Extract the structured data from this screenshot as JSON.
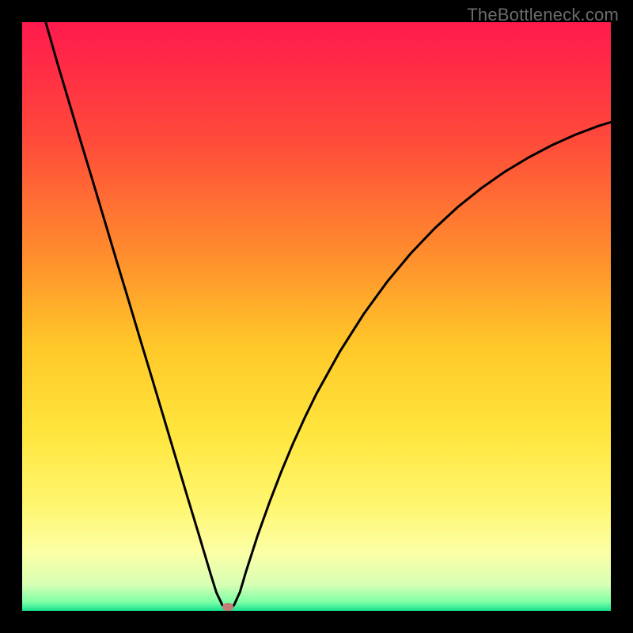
{
  "watermark": "TheBottleneck.com",
  "chart_data": {
    "type": "line",
    "title": "",
    "xlabel": "",
    "ylabel": "",
    "xlim": [
      0,
      100
    ],
    "ylim": [
      0,
      100
    ],
    "grid": false,
    "legend": false,
    "annotations": [],
    "background_gradient": {
      "stops": [
        {
          "pos": 0.0,
          "color": "#ff1a4d"
        },
        {
          "pos": 0.2,
          "color": "#ff4a3a"
        },
        {
          "pos": 0.4,
          "color": "#ff8f2d"
        },
        {
          "pos": 0.55,
          "color": "#ffc829"
        },
        {
          "pos": 0.7,
          "color": "#ffe63e"
        },
        {
          "pos": 0.82,
          "color": "#fff66f"
        },
        {
          "pos": 0.9,
          "color": "#fcffa5"
        },
        {
          "pos": 0.955,
          "color": "#d8ffb5"
        },
        {
          "pos": 0.985,
          "color": "#7effa5"
        },
        {
          "pos": 1.0,
          "color": "#18e08f"
        }
      ]
    },
    "series": [
      {
        "name": "bottleneck-curve",
        "color": "#000000",
        "x": [
          4,
          6,
          8,
          10,
          12,
          14,
          16,
          18,
          20,
          22,
          24,
          26,
          28,
          30,
          32,
          33,
          34,
          35,
          36,
          37,
          38,
          40,
          42,
          44,
          46,
          48,
          50,
          54,
          58,
          62,
          66,
          70,
          74,
          78,
          82,
          86,
          90,
          94,
          98,
          100
        ],
        "y": [
          100,
          93,
          86.3,
          79.6,
          73,
          66.3,
          59.6,
          53,
          46.3,
          39.7,
          33,
          26.3,
          19.6,
          13,
          6.3,
          3.1,
          1.0,
          0,
          1.0,
          3.2,
          6.6,
          12.8,
          18.4,
          23.6,
          28.4,
          32.8,
          36.9,
          44.1,
          50.4,
          55.9,
          60.7,
          64.9,
          68.6,
          71.8,
          74.6,
          77.0,
          79.1,
          80.9,
          82.4,
          83.0
        ]
      }
    ],
    "marker": {
      "x": 35.0,
      "y": 0.7,
      "color": "#c57d78"
    }
  }
}
